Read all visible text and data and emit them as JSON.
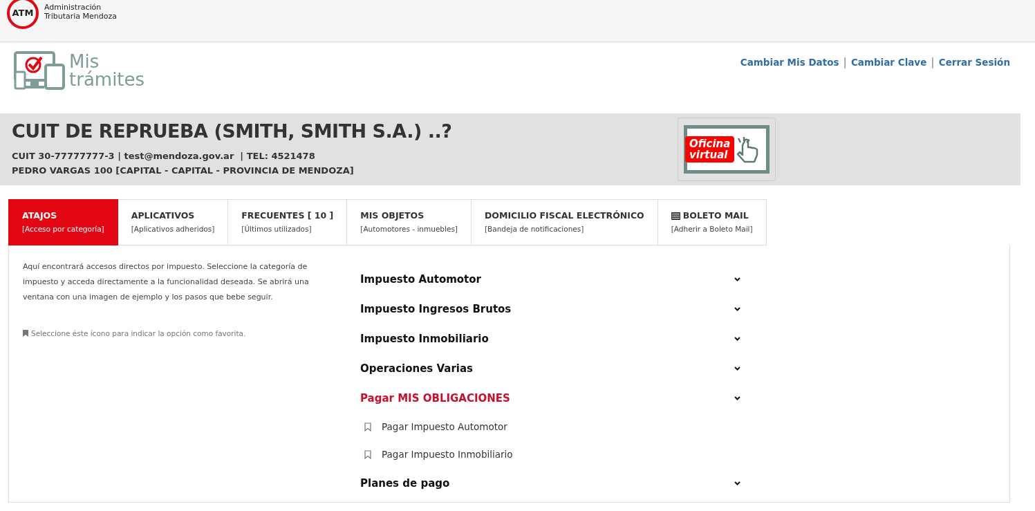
{
  "brand": {
    "logo_text": "ATM",
    "name_line1": "Administración",
    "name_line2": "Tributaria Mendoza"
  },
  "app_logo": {
    "line1": "Mis",
    "line2": "trámites"
  },
  "user_links": [
    "Cambiar Mis Datos",
    "Cambiar Clave",
    "Cerrar Sesión"
  ],
  "link_separator": "|",
  "taxpayer": {
    "name": "CUIT DE REPRUEBA (SMITH, SMITH S.A.) ..?",
    "details": "CUIT 30-77777777-3 | test@mendoza.gov.ar  | TEL: 4521478",
    "address": "PEDRO VARGAS 100 [CAPITAL - CAPITAL - PROVINCIA DE MENDOZA]"
  },
  "virtual_office": {
    "line1": "Oficina",
    "line2": "virtual"
  },
  "tabs": [
    {
      "kind": "plain",
      "title": "ATAJOS",
      "subtitle": "[Acceso por categoría]",
      "selected": true
    },
    {
      "kind": "plain",
      "title": "APLICATIVOS",
      "subtitle": "[Aplicativos adheridos]",
      "selected": false
    },
    {
      "kind": "plain",
      "title": "FRECUENTES [ 10 ]",
      "subtitle": "[Últimos utilizados]",
      "selected": false
    },
    {
      "kind": "plain",
      "title": "MIS OBJETOS",
      "subtitle": "[Automotores - inmuebles]",
      "selected": false
    },
    {
      "kind": "plain",
      "title": "DOMICILIO FISCAL ELECTRÓNICO",
      "subtitle": "[Bandeja de notificaciones]",
      "selected": false
    },
    {
      "kind": "mail",
      "title": "BOLETO MAIL",
      "subtitle": "[Adherir a Boleto Mail]",
      "selected": false
    }
  ],
  "intro": "Aquí encontrará accesos directos por impuesto. Seleccione la categoría de impuesto y acceda directamente a la funcionalidad deseada. Se abrirá una ventana con una imagen de ejemplo y los pasos que bebe seguir.",
  "favorite_hint": "Seleccione éste ícono para indicar la opción como favorita.",
  "categories": [
    {
      "label": "Impuesto Automotor",
      "expanded": false
    },
    {
      "label": "Impuesto Ingresos Brutos",
      "expanded": false
    },
    {
      "label": "Impuesto Inmobiliario",
      "expanded": false
    },
    {
      "label": "Operaciones Varias",
      "expanded": false
    },
    {
      "label": "Pagar MIS OBLIGACIONES",
      "expanded": true,
      "children": [
        {
          "label": "Pagar Impuesto Automotor",
          "favorite": false
        },
        {
          "label": "Pagar Impuesto Inmobiliario",
          "favorite": false
        }
      ]
    },
    {
      "label": "Planes de pago",
      "expanded": false
    }
  ]
}
